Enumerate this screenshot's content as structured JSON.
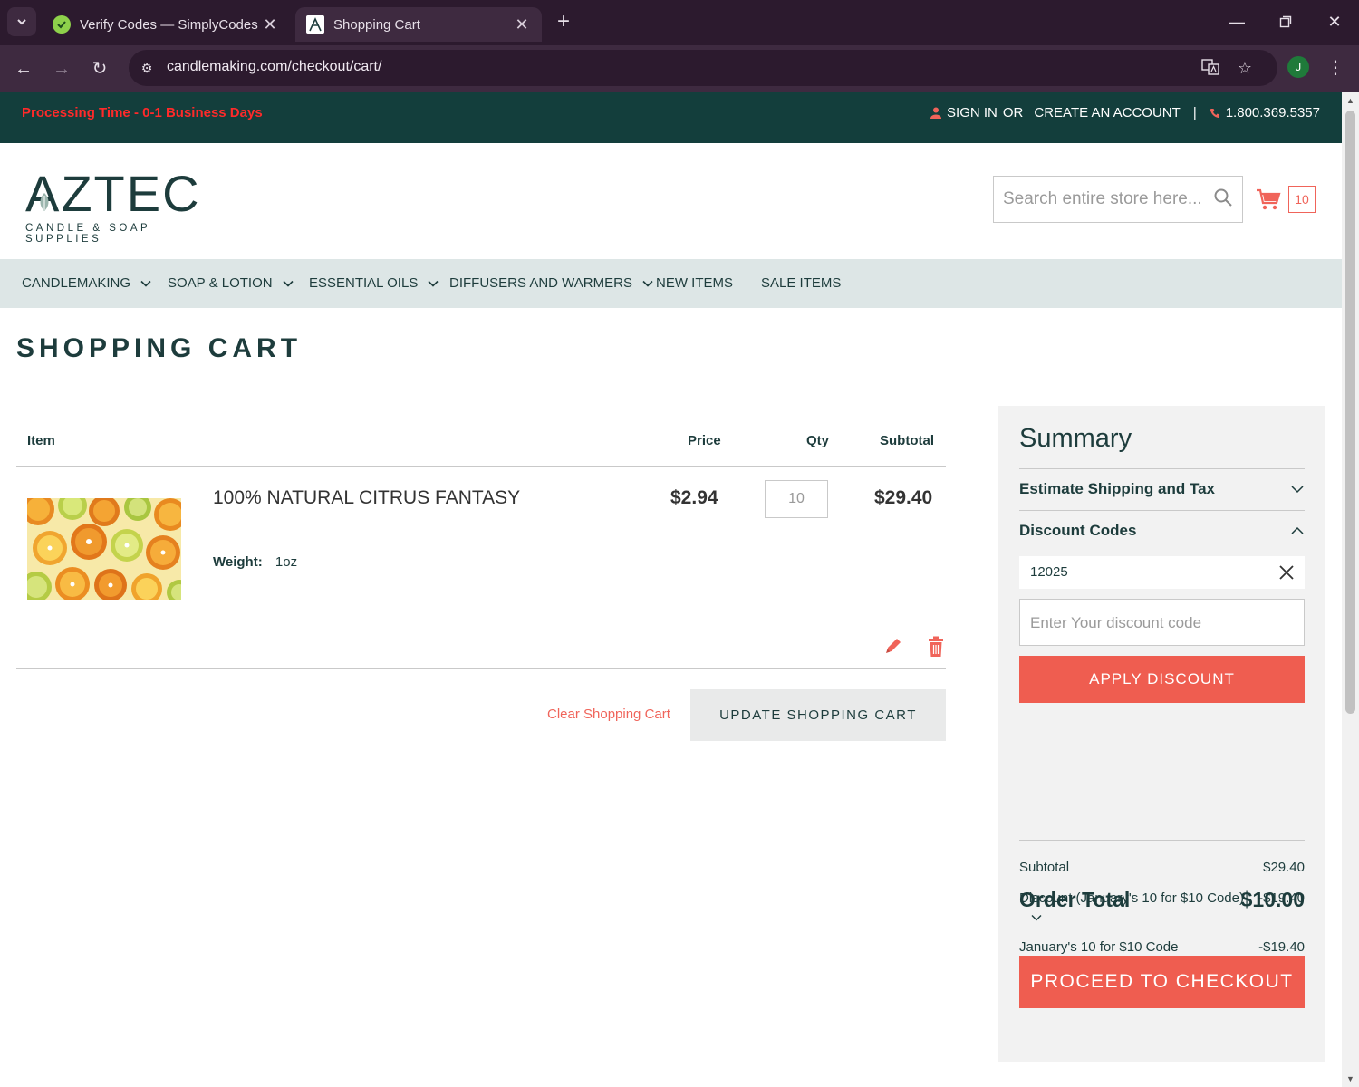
{
  "browser": {
    "tabs": [
      {
        "title": "Verify Codes — SimplyCodes",
        "active": false
      },
      {
        "title": "Shopping Cart",
        "active": true
      }
    ],
    "url": "candlemaking.com/checkout/cart/",
    "profile_initial": "J"
  },
  "topbar": {
    "processing": "Processing Time - 0-1 Business Days",
    "sign_in": "SIGN IN",
    "or": "OR",
    "create_account": "CREATE AN ACCOUNT",
    "separator": "|",
    "phone": "1.800.369.5357"
  },
  "header": {
    "logo_main": "AZTEC",
    "logo_sub": "CANDLE & SOAP SUPPLIES",
    "search_placeholder": "Search entire store here...",
    "cart_count": "10"
  },
  "nav": [
    {
      "label": "CANDLEMAKING",
      "dropdown": true
    },
    {
      "label": "SOAP & LOTION",
      "dropdown": true
    },
    {
      "label": "ESSENTIAL OILS",
      "dropdown": true
    },
    {
      "label": "DIFFUSERS AND WARMERS",
      "dropdown": true
    },
    {
      "label": "NEW ITEMS",
      "dropdown": false
    },
    {
      "label": "SALE ITEMS",
      "dropdown": false
    }
  ],
  "cart": {
    "title": "SHOPPING CART",
    "columns": {
      "item": "Item",
      "price": "Price",
      "qty": "Qty",
      "subtotal": "Subtotal"
    },
    "items": [
      {
        "name": "100% NATURAL CITRUS FANTASY",
        "weight_label": "Weight:",
        "weight_value": "1oz",
        "price": "$2.94",
        "qty": "10",
        "subtotal": "$29.40"
      }
    ],
    "clear_label": "Clear Shopping Cart",
    "update_label": "UPDATE SHOPPING CART"
  },
  "summary": {
    "title": "Summary",
    "shipping_label": "Estimate Shipping and Tax",
    "discount_label": "Discount Codes",
    "applied_code": "12025",
    "code_placeholder": "Enter Your discount code",
    "apply_label": "APPLY DISCOUNT",
    "subtotal_label": "Subtotal",
    "subtotal_value": "$29.40",
    "discount_row_label": "Discount (January's 10 for $10 Code)",
    "discount_row_value": "-$19.40",
    "discount_detail_label": "January's 10 for $10 Code",
    "discount_detail_value": "-$19.40",
    "order_total_label": "Order Total",
    "order_total_value": "$10.00",
    "checkout_label": "PROCEED TO CHECKOUT"
  },
  "colors": {
    "brand_dark": "#133e3c",
    "accent": "#ef5d50",
    "processing_red": "#ff2a2a",
    "nav_bg": "#dde6e6"
  }
}
